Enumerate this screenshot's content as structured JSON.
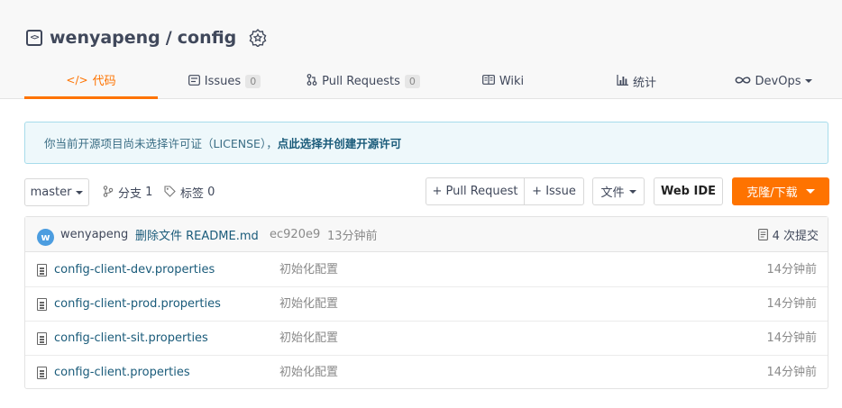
{
  "repo": {
    "owner": "wenyapeng",
    "separator": "/",
    "name": "config"
  },
  "tabs": [
    {
      "label": "代码",
      "icon": "code-icon",
      "active": true
    },
    {
      "label": "Issues",
      "icon": "issues-icon",
      "count": "0"
    },
    {
      "label": "Pull Requests",
      "icon": "pull-request-icon",
      "count": "0"
    },
    {
      "label": "Wiki",
      "icon": "wiki-icon"
    },
    {
      "label": "统计",
      "icon": "stats-icon"
    },
    {
      "label": "DevOps",
      "icon": "devops-icon"
    }
  ],
  "notice": {
    "text": "你当前开源项目尚未选择许可证（LICENSE），",
    "link": "点此选择并创建开源许可"
  },
  "toolbar": {
    "branch": "master",
    "branches_label": "分支",
    "branches_count": "1",
    "tags_label": "标签",
    "tags_count": "0",
    "pull_request_btn": "+ Pull Request",
    "issue_btn": "+ Issue",
    "file_btn": "文件",
    "webide_btn": "Web IDE",
    "clone_btn": "克隆/下载"
  },
  "commit": {
    "avatar_letter": "w",
    "author": "wenyapeng",
    "message": "删除文件 README.md",
    "hash": "ec920e9",
    "time": "13分钟前",
    "commits_label": "4 次提交"
  },
  "files": [
    {
      "name": "config-client-dev.properties",
      "message": "初始化配置",
      "time": "14分钟前"
    },
    {
      "name": "config-client-prod.properties",
      "message": "初始化配置",
      "time": "14分钟前"
    },
    {
      "name": "config-client-sit.properties",
      "message": "初始化配置",
      "time": "14分钟前"
    },
    {
      "name": "config-client.properties",
      "message": "初始化配置",
      "time": "14分钟前"
    }
  ],
  "colors": {
    "accent": "#fe7300",
    "link": "#1a5b7a",
    "notice_bg": "#eef8fb"
  }
}
